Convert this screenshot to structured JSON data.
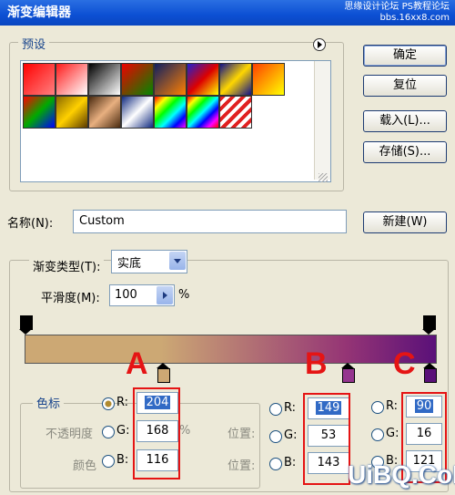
{
  "window": {
    "title": "渐变编辑器",
    "watermark_line1": "思缘设计论坛",
    "watermark_line2": "PS教程论坛",
    "watermark_line3": "bbs.16xx8.com"
  },
  "presets": {
    "legend": "预设",
    "menu_icon": "arrow-right-circle-icon"
  },
  "buttons": {
    "ok": "确定",
    "reset": "复位",
    "load": "载入(L)...",
    "save": "存储(S)...",
    "new": "新建(W)"
  },
  "name": {
    "label": "名称(N):",
    "value": "Custom"
  },
  "gradient": {
    "type_label": "渐变类型(T):",
    "type_value": "实底",
    "smoothness_label": "平滑度(M):",
    "smoothness_value": "100",
    "smoothness_unit": "%",
    "colors": {
      "left": "#cca874",
      "mid": "#953575",
      "right": "#5a1079"
    }
  },
  "stops": {
    "legend": "色标",
    "opacity_label": "不透明度",
    "color_label": "颜色",
    "location_label1": "位置:",
    "location_label2": "位置:"
  },
  "panel_a": {
    "letter": "A",
    "r_label": "R:",
    "r": "204",
    "g_label": "G:",
    "g": "168",
    "b_label": "B:",
    "b": "116",
    "pct": "%",
    "color": "#cca874"
  },
  "panel_b": {
    "letter": "B",
    "r_label": "R:",
    "r": "149",
    "g_label": "G:",
    "g": "53",
    "b_label": "B:",
    "b": "143",
    "color": "#95358f"
  },
  "panel_c": {
    "letter": "C",
    "r_label": "R:",
    "r": "90",
    "g_label": "G:",
    "g": "16",
    "b_label": "B:",
    "b": "121",
    "color": "#5a1079"
  },
  "site_watermark": "UiBQ.CoM"
}
